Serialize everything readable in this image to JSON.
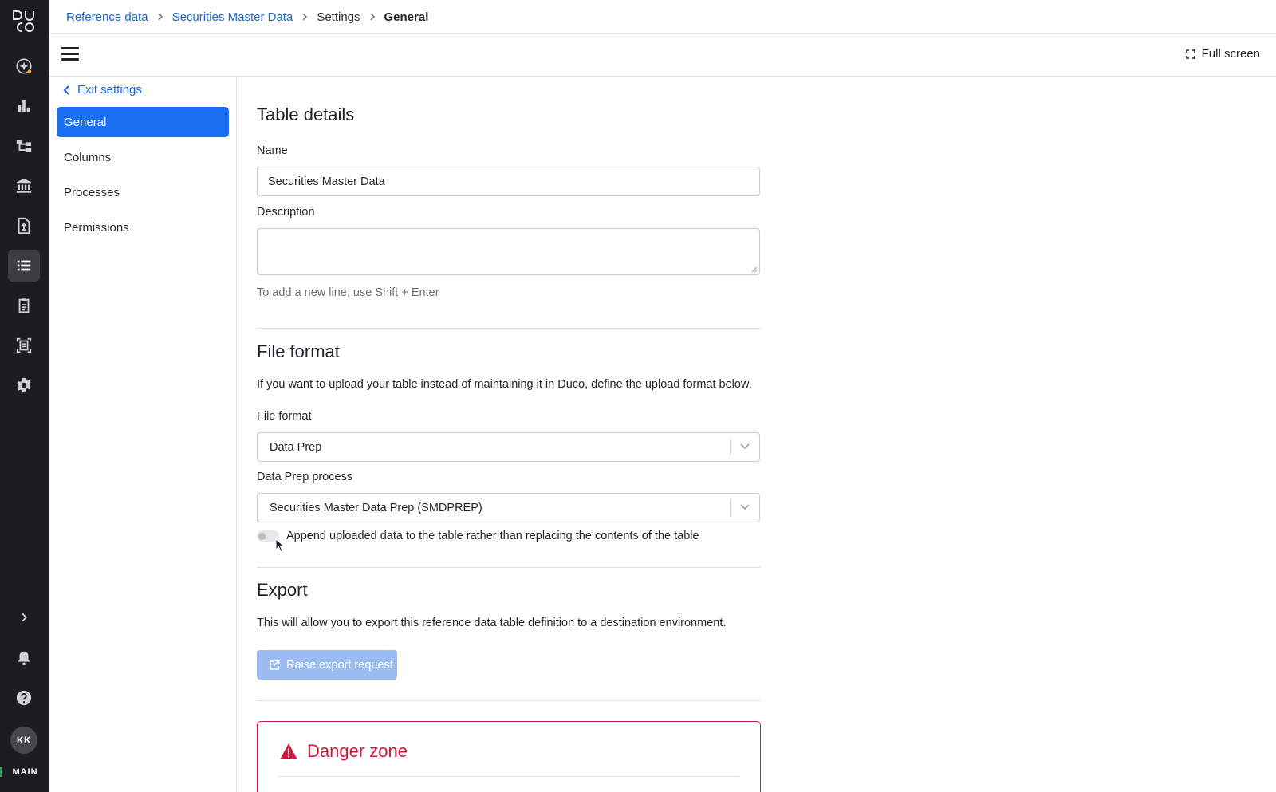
{
  "app": {
    "logo_text": "DUCO",
    "user_initials": "KK",
    "environment": "MAIN"
  },
  "rail": {
    "items": [
      {
        "icon": "sparkle-icon"
      },
      {
        "icon": "bar-chart-icon"
      },
      {
        "icon": "hierarchy-icon"
      },
      {
        "icon": "bank-icon"
      },
      {
        "icon": "file-upload-icon"
      },
      {
        "icon": "table-list-icon",
        "active": true
      },
      {
        "icon": "clipboard-icon"
      },
      {
        "icon": "scan-document-icon"
      },
      {
        "icon": "gear-icon"
      }
    ],
    "bottom": [
      "expand-chevron-icon",
      "bell-icon",
      "help-icon"
    ]
  },
  "breadcrumb": {
    "items": [
      "Reference data",
      "Securities Master Data",
      "Settings",
      "General"
    ]
  },
  "toolbar": {
    "fullscreen_label": "Full screen"
  },
  "settings_nav": {
    "exit_label": "Exit settings",
    "items": [
      "General",
      "Columns",
      "Processes",
      "Permissions"
    ],
    "active": "General"
  },
  "table_details": {
    "title": "Table details",
    "name_label": "Name",
    "name_value": "Securities Master Data",
    "description_label": "Description",
    "description_value": "",
    "description_hint": "To add a new line, use Shift + Enter"
  },
  "file_format": {
    "title": "File format",
    "intro": "If you want to upload your table instead of maintaining it in Duco, define the upload format below.",
    "format_label": "File format",
    "format_value": "Data Prep",
    "process_label": "Data Prep process",
    "process_value": "Securities Master Data Prep (SMDPREP)",
    "append_label": "Append uploaded data to the table rather than replacing the contents of the table",
    "append_enabled": false
  },
  "export": {
    "title": "Export",
    "intro": "This will allow you to export this reference data table definition to a destination environment.",
    "button_label": "Raise export request"
  },
  "danger_zone": {
    "title": "Danger zone"
  },
  "colors": {
    "rail_bg": "#1c1d21",
    "accent": "#1a6ff0",
    "link": "#1a66d8",
    "danger": "#d0193a",
    "env_indicator": "#2aa96a"
  }
}
